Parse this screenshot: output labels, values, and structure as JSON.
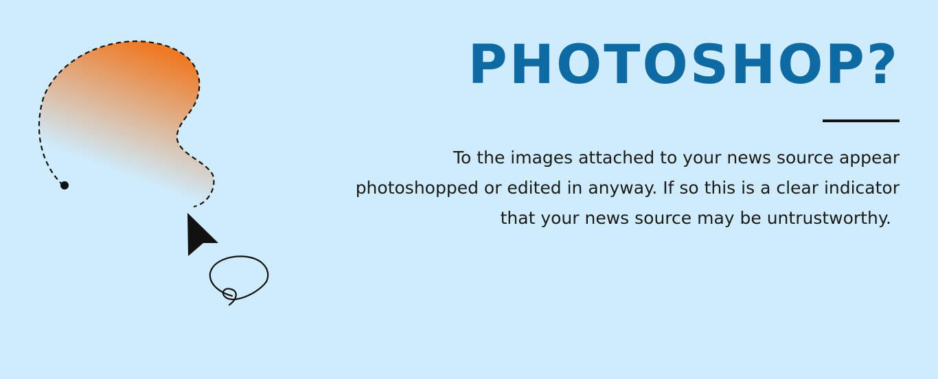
{
  "colors": {
    "background": "#cfecfd",
    "title": "#0e6aa3",
    "blob_gradient_top": "#ef7a25",
    "blob_gradient_bottom": "#cfecfd",
    "outline": "#111111"
  },
  "heading": {
    "title": "PHOTOSHOP?"
  },
  "body": {
    "lines": [
      "To the images attached to your news source appear",
      "photoshopped or edited in anyway. If so this is a clear indicator",
      "that your news source may be untrustworthy."
    ]
  },
  "illustration": {
    "icons": [
      "lasso-selection-icon",
      "mouse-cursor-icon",
      "lasso-loop-icon"
    ]
  }
}
